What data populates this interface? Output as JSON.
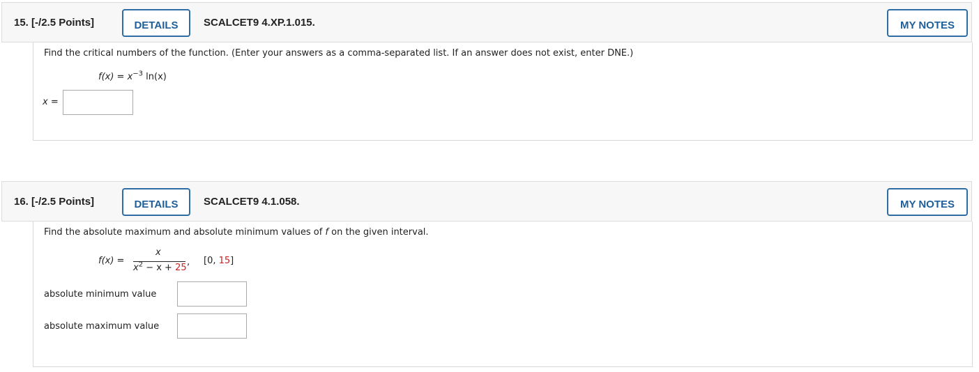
{
  "questions": [
    {
      "number_label": "15.",
      "points_label": "[-/2.5 Points]",
      "details_label": "DETAILS",
      "code": "SCALCET9 4.XP.1.015.",
      "notes_label": "MY NOTES",
      "prompt": "Find the critical numbers of the function. (Enter your answers as a comma-separated list. If an answer does not exist, enter DNE.)",
      "function": {
        "lhs": "f(x) = x",
        "exponent": "−3",
        "rhs": " ln(x)"
      },
      "answer_label": "x =",
      "answer_value": ""
    },
    {
      "number_label": "16.",
      "points_label": "[-/2.5 Points]",
      "details_label": "DETAILS",
      "code": "SCALCET9 4.1.058.",
      "notes_label": "MY NOTES",
      "prompt_start": "Find the absolute maximum and absolute minimum values of ",
      "prompt_var": "f",
      "prompt_end": " on the given interval.",
      "function": {
        "lhs": "f(x) =",
        "numerator": "x",
        "denominator_x": "x",
        "denominator_exp": "2",
        "denominator_mid": " − x + ",
        "denominator_const": "25",
        "comma": ",",
        "interval_open": "[0, ",
        "interval_upper": "15",
        "interval_close": "]"
      },
      "min_label": "absolute minimum value",
      "min_value": "",
      "max_label": "absolute maximum value",
      "max_value": ""
    }
  ],
  "colors": {
    "button_border": "#2e6da4",
    "button_text": "#1f5f99",
    "highlight_red": "#cc1f1f",
    "header_bg": "#f7f7f7"
  }
}
